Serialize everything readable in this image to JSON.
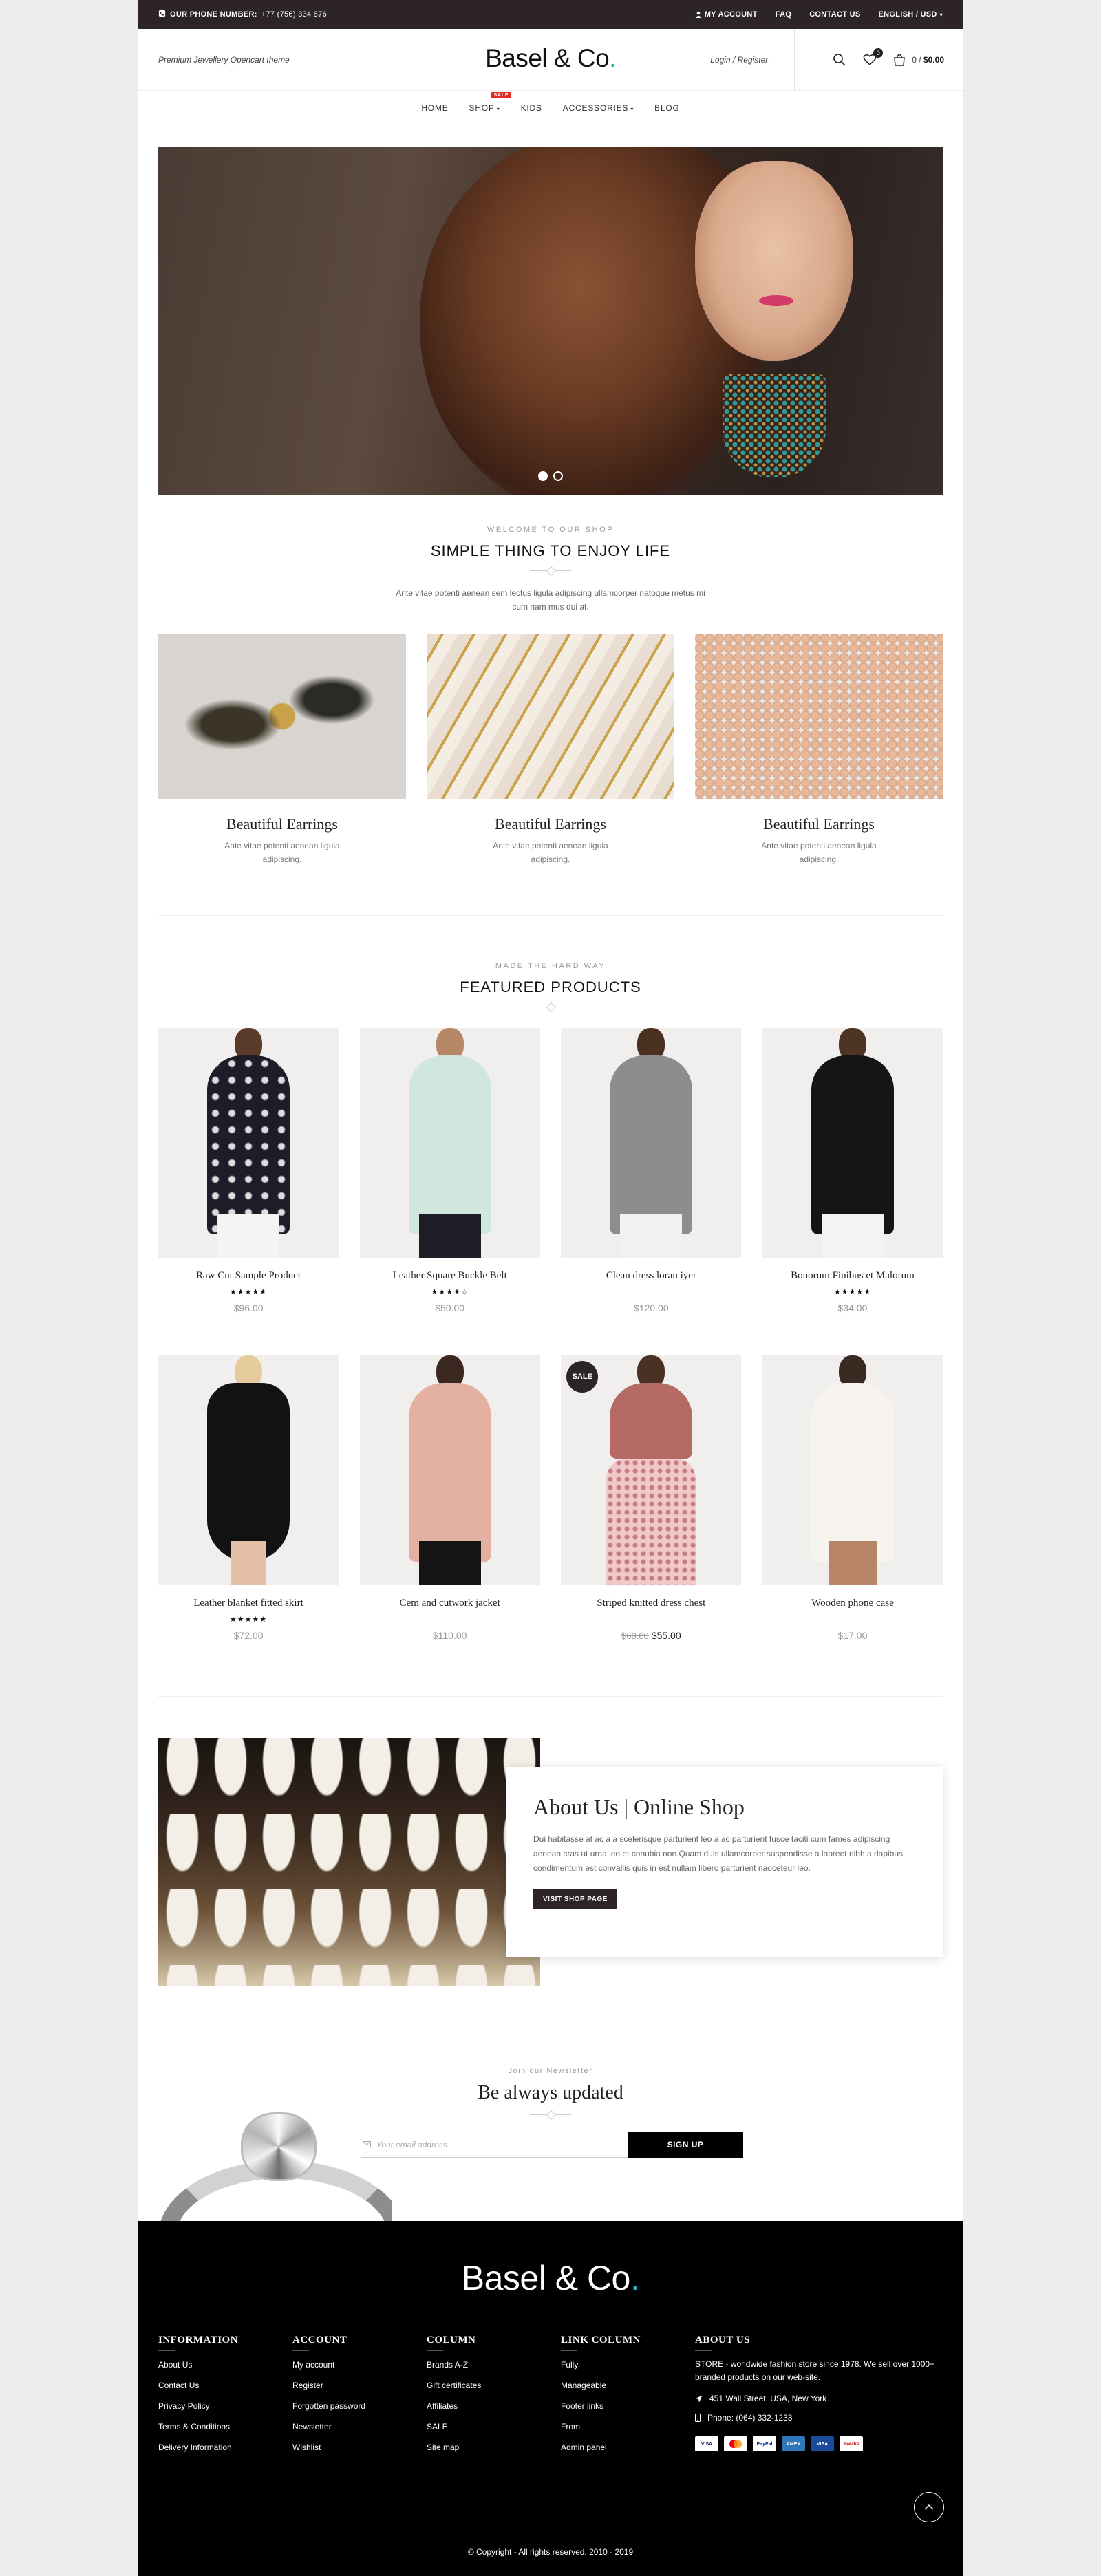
{
  "topbar": {
    "phone_label": "OUR PHONE NUMBER:",
    "phone": "+77 (756) 334 876",
    "links": [
      "MY ACCOUNT",
      "FAQ",
      "CONTACT US",
      "ENGLISH / USD"
    ]
  },
  "header": {
    "tagline": "Premium Jewellery Opencart theme",
    "logo": "Basel & Co",
    "logo_dot": ".",
    "login": "Login / Register",
    "wishlist_count": "0",
    "cart_count": "0",
    "cart_total": "$0.00"
  },
  "nav": {
    "items": [
      "HOME",
      "SHOP",
      "KIDS",
      "ACCESSORIES",
      "BLOG"
    ],
    "sale_tag": "SALE"
  },
  "welcome": {
    "eyebrow": "WELCOME TO OUR SHOP",
    "title": "SIMPLE THING TO ENJOY LIFE",
    "text": "Ante vitae potenti aenean sem lectus ligula adipiscing ullamcorper natoque metus mi cum nam mus dui at."
  },
  "categories": [
    {
      "title": "Beautiful Earrings",
      "desc": "Ante vitae potenti aenean ligula adipiscing."
    },
    {
      "title": "Beautiful Earrings",
      "desc": "Ante vitae potenti aenean ligula adipiscing."
    },
    {
      "title": "Beautiful Earrings",
      "desc": "Ante vitae potenti aenean ligula adipiscing."
    }
  ],
  "featured": {
    "eyebrow": "MADE THE HARD WAY",
    "title": "FEATURED PRODUCTS",
    "products": [
      {
        "name": "Raw Cut Sample Product",
        "stars": "★★★★★",
        "price": "$96.00",
        "rating": 5
      },
      {
        "name": "Leather Square Buckle Belt",
        "stars": "★★★★☆",
        "price": "$50.00",
        "rating": 4
      },
      {
        "name": "Clean dress loran iyer",
        "stars": "",
        "price": "$120.00",
        "rating": 0
      },
      {
        "name": "Bonorum Finibus et Malorum",
        "stars": "★★★★★",
        "price": "$34.00",
        "rating": 5
      },
      {
        "name": "Leather blanket fitted skirt",
        "stars": "★★★★★",
        "price": "$72.00",
        "rating": 5
      },
      {
        "name": "Cem and cutwork jacket",
        "stars": "",
        "price": "$110.00",
        "rating": 0
      },
      {
        "name": "Striped knitted dress chest",
        "stars": "",
        "old_price": "$68.00",
        "price": "$55.00",
        "rating": 0,
        "badge": "SALE"
      },
      {
        "name": "Wooden phone case",
        "stars": "",
        "price": "$17.00",
        "rating": 0
      }
    ]
  },
  "about": {
    "title": "About Us | Online Shop",
    "text": "Dui habitasse at ac a a scelerisque parturient leo a ac parturient fusce taciti cum fames adipiscing aenean cras ut urna leo et conubia non.Quam duis ullamcorper suspendisse a laoreet nibh a dapibus condimentum est convallis quis in est nullam libero parturient naoceteur leo.",
    "button": "VISIT SHOP PAGE"
  },
  "newsletter": {
    "eyebrow": "Join our Newsletter",
    "title": "Be always updated",
    "placeholder": "Your email address",
    "button": "SIGN UP"
  },
  "footer": {
    "logo": "Basel & Co",
    "logo_dot": ".",
    "columns": [
      {
        "title": "INFORMATION",
        "links": [
          "About Us",
          "Contact Us",
          "Privacy Policy",
          "Terms & Conditions",
          "Delivery Information"
        ]
      },
      {
        "title": "ACCOUNT",
        "links": [
          "My account",
          "Register",
          "Forgotten password",
          "Newsletter",
          "Wishlist"
        ]
      },
      {
        "title": "COLUMN",
        "links": [
          "Brands A-Z",
          "Gift certificates",
          "Affiliates",
          "SALE",
          "Site map"
        ]
      },
      {
        "title": "LINK COLUMN",
        "links": [
          "Fully",
          "Manageable",
          "Footer links",
          "From",
          "Admin panel"
        ]
      }
    ],
    "about_title": "ABOUT US",
    "about_text": "STORE - worldwide fashion store since 1978. We sell over 1000+ branded products on our web-site.",
    "address": "451 Wall Street, USA, New York",
    "phone": "Phone: (064) 332-1233",
    "payment_cards": [
      "VISA",
      "MC",
      "PayPal",
      "AMEX",
      "VISA",
      "Maestro"
    ],
    "copyright": "© Copyright - All rights reserved. 2010 - 2019"
  },
  "colors": {
    "topbar": "#2d2426",
    "accent_dot": "#20b5b1",
    "sale": "#e02b27",
    "footer": "#000000"
  }
}
